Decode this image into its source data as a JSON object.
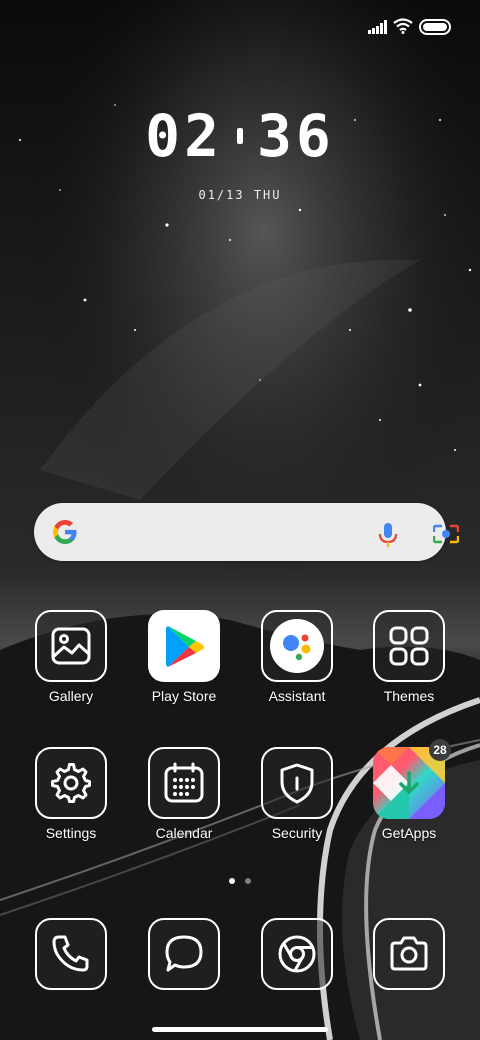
{
  "status_bar": {
    "signal_icon": "signal-icon",
    "wifi_icon": "wifi-icon",
    "battery_icon": "battery-icon"
  },
  "clock": {
    "hours": "02",
    "minutes": "36",
    "date": "01/13 THU"
  },
  "search": {
    "logo": "google-logo",
    "mic_icon": "mic-icon",
    "lens_icon": "lens-icon"
  },
  "apps_row1": [
    {
      "label": "Gallery",
      "icon": "gallery-icon"
    },
    {
      "label": "Play Store",
      "icon": "play-store-icon"
    },
    {
      "label": "Assistant",
      "icon": "assistant-icon"
    },
    {
      "label": "Themes",
      "icon": "themes-icon"
    }
  ],
  "apps_row2": [
    {
      "label": "Settings",
      "icon": "settings-icon"
    },
    {
      "label": "Calendar",
      "icon": "calendar-icon"
    },
    {
      "label": "Security",
      "icon": "security-icon"
    },
    {
      "label": "GetApps",
      "icon": "getapps-icon",
      "badge": "28"
    }
  ],
  "page_indicator": {
    "pages": 2,
    "active": 1
  },
  "dock": [
    {
      "icon": "phone-icon"
    },
    {
      "icon": "messages-icon"
    },
    {
      "icon": "chrome-icon"
    },
    {
      "icon": "camera-icon"
    }
  ]
}
